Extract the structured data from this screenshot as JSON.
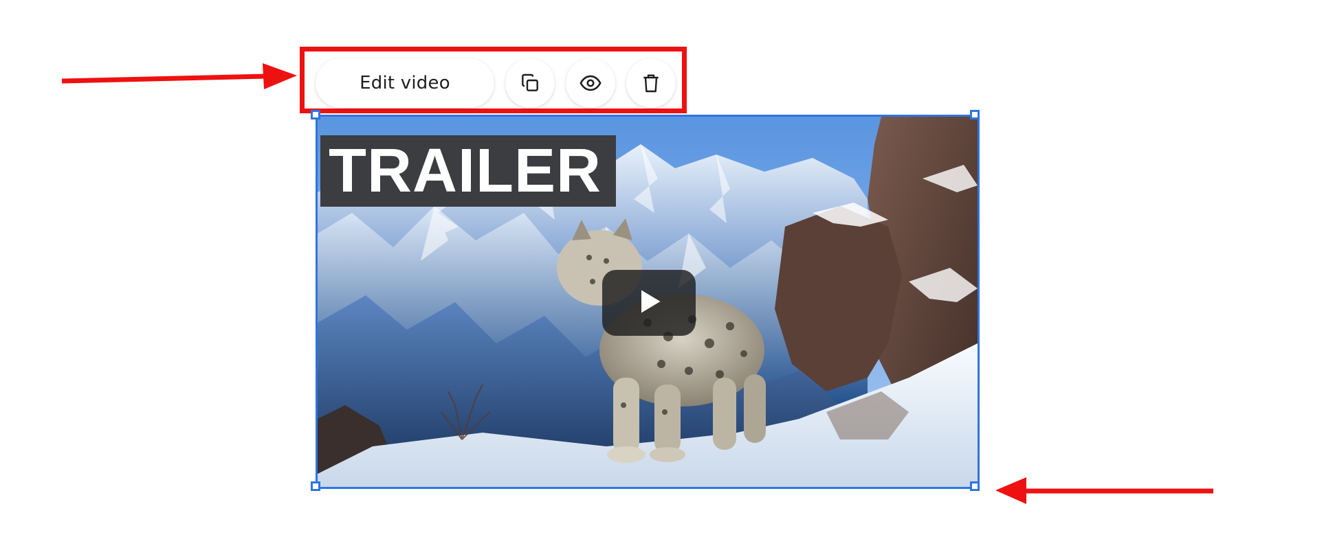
{
  "toolbar": {
    "edit_label": "Edit video",
    "buttons": {
      "duplicate_icon": "duplicate-icon",
      "preview_icon": "eye-icon",
      "delete_icon": "trash-icon"
    }
  },
  "video": {
    "overlay_text": "TRAILER",
    "play_icon": "play-icon"
  },
  "colors": {
    "annotation": "#ee1111",
    "selection": "#2f74e0",
    "overlay_bg": "#3c3d40"
  }
}
